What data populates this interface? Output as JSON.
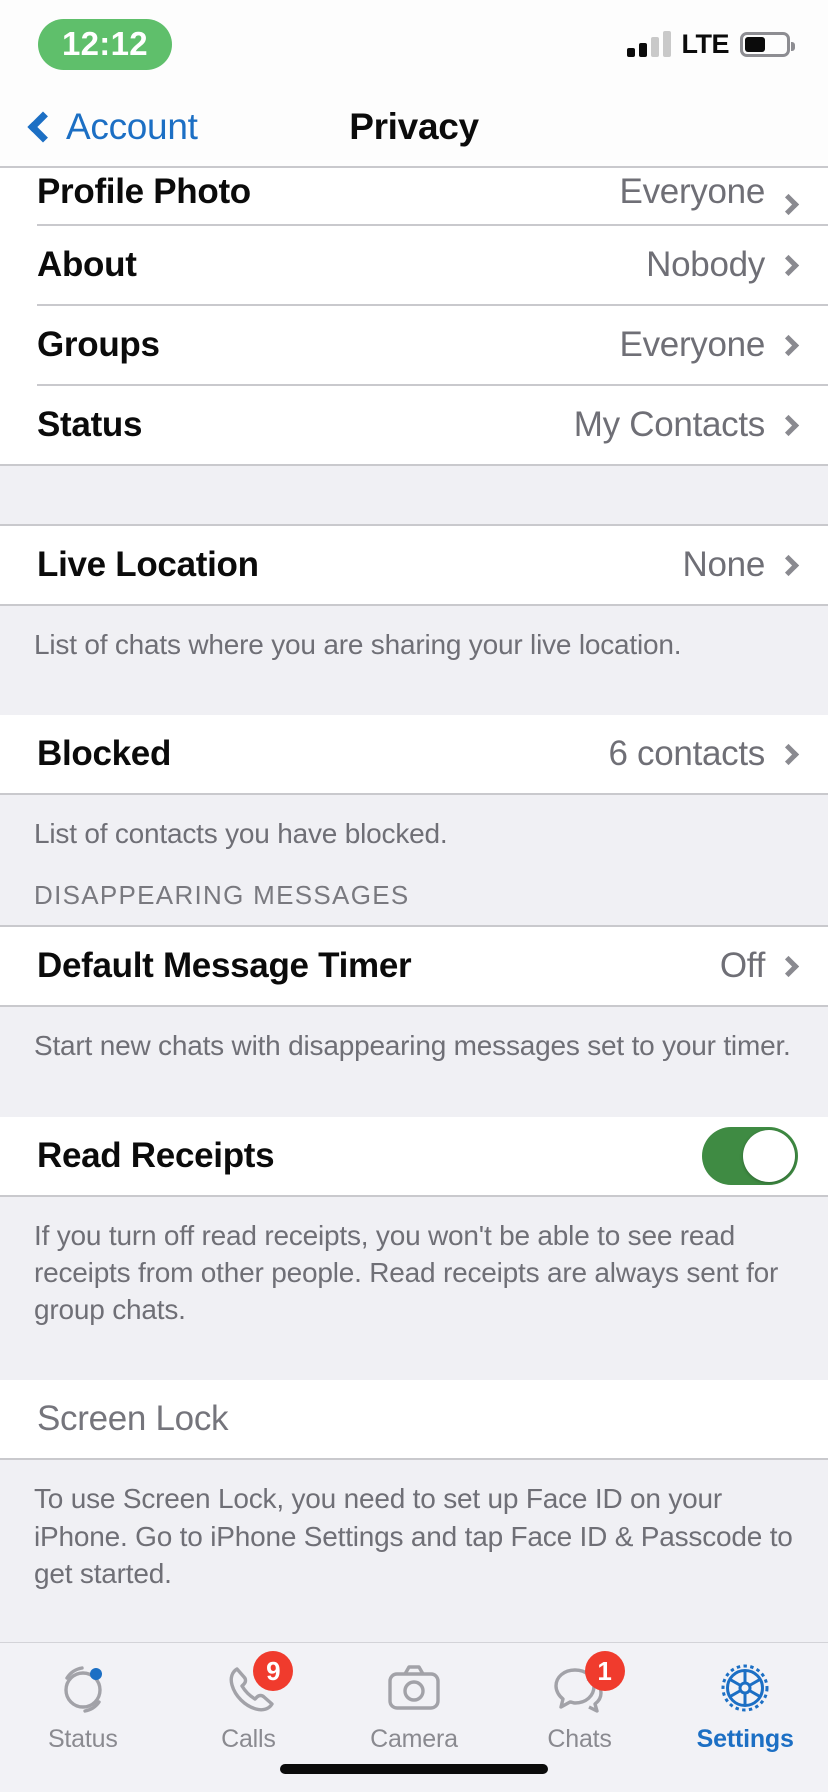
{
  "status_bar": {
    "time": "12:12",
    "network": "LTE",
    "signal_bars_filled": 2,
    "signal_bars_total": 4,
    "battery_percent": 50
  },
  "nav": {
    "back_label": "Account",
    "title": "Privacy"
  },
  "rows": {
    "profile_photo": {
      "label": "Profile Photo",
      "value": "Everyone"
    },
    "about": {
      "label": "About",
      "value": "Nobody"
    },
    "groups": {
      "label": "Groups",
      "value": "Everyone"
    },
    "status": {
      "label": "Status",
      "value": "My Contacts"
    },
    "live_location": {
      "label": "Live Location",
      "value": "None"
    },
    "blocked": {
      "label": "Blocked",
      "value": "6 contacts"
    },
    "default_message_timer": {
      "label": "Default Message Timer",
      "value": "Off"
    },
    "read_receipts": {
      "label": "Read Receipts",
      "toggle_on": true
    },
    "screen_lock": {
      "label": "Screen Lock"
    }
  },
  "footers": {
    "live_location": "List of chats where you are sharing your live location.",
    "blocked": "List of contacts you have blocked.",
    "default_message_timer": "Start new chats with disappearing messages set to your timer.",
    "read_receipts": "If you turn off read receipts, you won't be able to see read receipts from other people. Read receipts are always sent for group chats.",
    "screen_lock": "To use Screen Lock, you need to set up Face ID on your iPhone. Go to iPhone Settings and tap Face ID & Passcode to get started."
  },
  "section_headers": {
    "disappearing_messages": "DISAPPEARING MESSAGES"
  },
  "tabs": [
    {
      "label": "Status",
      "icon": "status-ring-icon",
      "badge": null,
      "active": false
    },
    {
      "label": "Calls",
      "icon": "phone-icon",
      "badge": "9",
      "active": false
    },
    {
      "label": "Camera",
      "icon": "camera-icon",
      "badge": null,
      "active": false
    },
    {
      "label": "Chats",
      "icon": "chat-bubbles-icon",
      "badge": "1",
      "active": false
    },
    {
      "label": "Settings",
      "icon": "gear-icon",
      "badge": null,
      "active": true
    }
  ],
  "colors": {
    "accent_blue": "#1c6fc4",
    "toggle_green": "#3f8b43",
    "badge_red": "#f03b2d",
    "group_bg": "#f0f0f4",
    "time_pill_green": "#5fbf6b"
  }
}
